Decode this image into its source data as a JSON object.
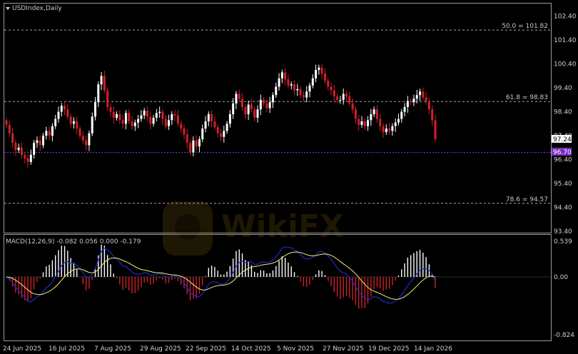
{
  "window": {
    "title": "USDIndex,Daily"
  },
  "colors": {
    "background": "#000000",
    "bull": "#ffffff",
    "bear": "#d0202a",
    "macd_line": "#1b2cc8",
    "signal_line": "#f0f07a",
    "histogram_positive": "#ffffff",
    "histogram_negative": "#d0202a",
    "current_price_box": "#ffffff",
    "support_box": "#7b2fbe"
  },
  "price_axis": {
    "ticks": [
      "102.40",
      "101.40",
      "100.40",
      "99.40",
      "98.40",
      "97.40",
      "96.40",
      "95.40",
      "94.40",
      "93.40"
    ],
    "current_price": "97.24",
    "marked_level": "96.70"
  },
  "fib_levels": [
    {
      "label": "50.0 = 101.82",
      "value": 101.82
    },
    {
      "label": "61.8 = 98.83",
      "value": 98.83
    },
    {
      "label": "78.6 = 94.57",
      "value": 94.57
    }
  ],
  "macd": {
    "label": "MACD(12,26,9) -0.082 0.056 0.000 -0.179",
    "axis_ticks": [
      "0.539",
      "0.00",
      "-0.824"
    ]
  },
  "time_axis": {
    "labels": [
      "24 Jun 2025",
      "16 Jul 2025",
      "7 Aug 2025",
      "29 Aug 2025",
      "22 Sep 2025",
      "14 Oct 2025",
      "5 Nov 2025",
      "27 Nov 2025",
      "19 Dec 2025",
      "14 Jan 2026"
    ]
  },
  "watermark": {
    "text": "WikiFX"
  },
  "chart_data": {
    "type": "candlestick",
    "title": "USDIndex,Daily",
    "ylim": [
      93.4,
      102.9
    ],
    "close": [
      97.85,
      97.5,
      97.1,
      96.8,
      96.9,
      96.6,
      96.45,
      96.3,
      96.6,
      97.1,
      97.2,
      97.0,
      97.4,
      97.6,
      97.4,
      97.8,
      98.1,
      98.4,
      98.65,
      98.5,
      98.2,
      97.9,
      98.0,
      97.7,
      97.4,
      97.2,
      97.0,
      97.5,
      98.2,
      98.8,
      99.55,
      99.9,
      99.3,
      98.6,
      98.4,
      98.15,
      98.3,
      98.05,
      97.9,
      98.35,
      98.0,
      97.8,
      97.95,
      98.1,
      98.25,
      98.45,
      98.2,
      97.9,
      98.15,
      98.35,
      98.4,
      98.1,
      97.8,
      98.05,
      98.3,
      98.25,
      97.9,
      97.7,
      97.45,
      97.1,
      96.7,
      97.2,
      96.95,
      97.25,
      97.7,
      98.0,
      98.3,
      98.0,
      97.75,
      97.5,
      97.35,
      97.6,
      97.9,
      98.3,
      98.75,
      99.15,
      98.95,
      98.6,
      98.3,
      98.7,
      98.5,
      98.15,
      98.5,
      98.9,
      98.75,
      98.55,
      98.8,
      99.1,
      99.45,
      99.8,
      100.05,
      99.75,
      99.5,
      99.55,
      99.3,
      99.35,
      99.1,
      99.0,
      99.25,
      99.5,
      99.8,
      100.15,
      100.25,
      100.0,
      99.7,
      99.45,
      99.3,
      99.05,
      98.9,
      98.9,
      99.15,
      99.05,
      98.75,
      98.5,
      98.1,
      97.85,
      98.0,
      97.8,
      98.05,
      98.3,
      98.5,
      98.1,
      97.8,
      97.55,
      97.7,
      97.6,
      97.8,
      97.95,
      98.1,
      98.4,
      98.6,
      98.85,
      98.8,
      98.95,
      99.1,
      99.25,
      99.0,
      98.85,
      98.5,
      98.05,
      97.25
    ]
  }
}
